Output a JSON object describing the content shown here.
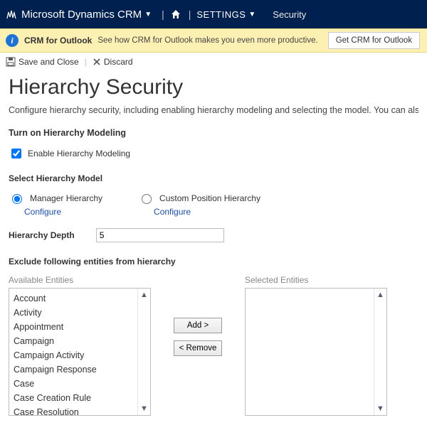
{
  "topnav": {
    "product": "Microsoft Dynamics CRM",
    "menu": "SETTINGS",
    "sub": "Security"
  },
  "infobar": {
    "title": "CRM for Outlook",
    "desc": "See how CRM for Outlook makes you even more productive.",
    "button": "Get CRM for Outlook"
  },
  "toolbar": {
    "save": "Save and Close",
    "discard": "Discard"
  },
  "page": {
    "title": "Hierarchy Security",
    "desc": "Configure hierarchy security, including enabling hierarchy modeling and selecting the model. You can also specify how deep the hierarchy goes, and specify the entities to exclude from the hierarchy.",
    "turn_on_head": "Turn on Hierarchy Modeling",
    "enable_label": "Enable Hierarchy Modeling",
    "enable_checked": true,
    "select_model_head": "Select Hierarchy Model",
    "radio_manager": "Manager Hierarchy",
    "radio_custom": "Custom Position Hierarchy",
    "configure": "Configure",
    "depth_label": "Hierarchy Depth",
    "depth_value": "5",
    "exclude_head": "Exclude following entities from hierarchy",
    "available_label": "Available Entities",
    "selected_label": "Selected Entities",
    "add_btn": "Add >",
    "remove_btn": "< Remove",
    "available_items": [
      "Account",
      "Activity",
      "Appointment",
      "Campaign",
      "Campaign Activity",
      "Campaign Response",
      "Case",
      "Case Creation Rule",
      "Case Resolution"
    ]
  }
}
